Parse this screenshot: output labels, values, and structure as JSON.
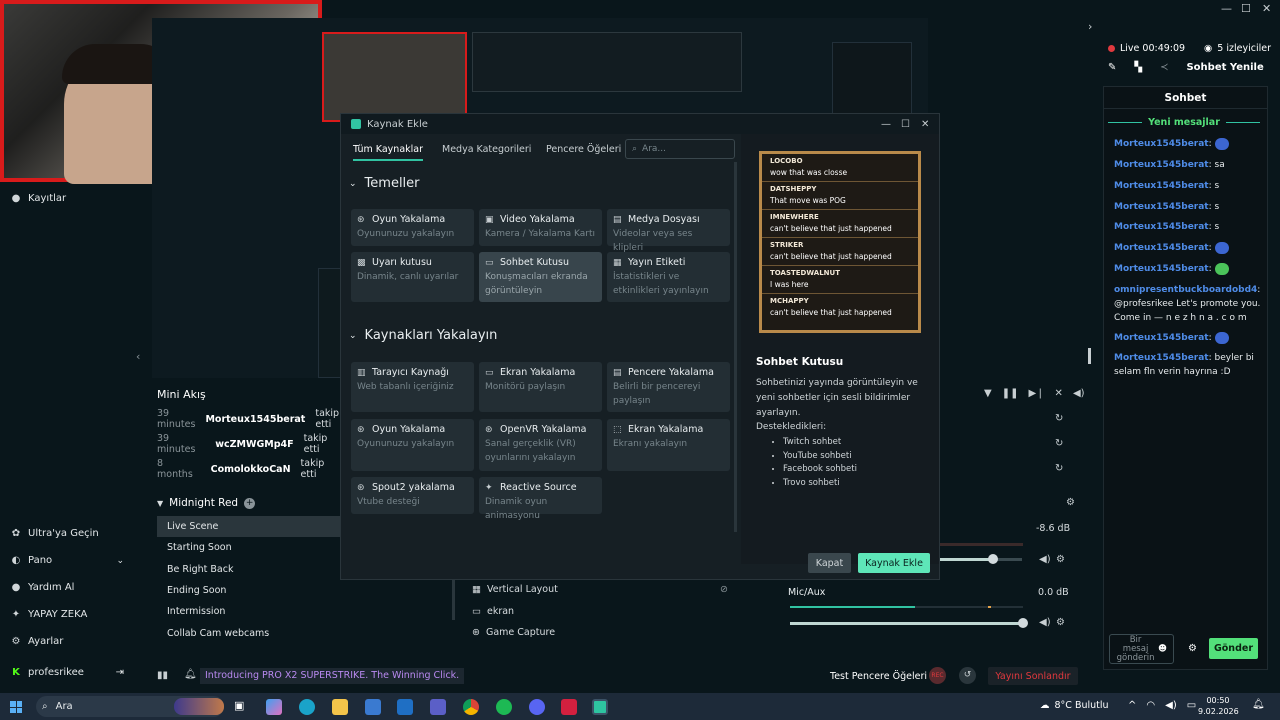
{
  "stream_status": {
    "live_label": "Live 00:49:09",
    "viewers": "5 izleyiciler",
    "refresh_chat": "Sohbet Yenile"
  },
  "sidebar": {
    "recordings": "Kayıtlar",
    "bottom_items": [
      {
        "label": "Ultra'ya Geçin",
        "icon": "ultra-icon"
      },
      {
        "label": "Pano",
        "icon": "dashboard-icon"
      },
      {
        "label": "Yardım Al",
        "icon": "help-icon"
      },
      {
        "label": "YAPAY ZEKA",
        "icon": "ai-icon"
      },
      {
        "label": "Ayarlar",
        "icon": "gear-icon"
      },
      {
        "label": "profesrikee",
        "icon": "kick-icon"
      }
    ]
  },
  "mini_feed": {
    "title": "Mini Akış",
    "rows": [
      {
        "time": "39 minutes",
        "user": "Morteux1545berat",
        "action": "takip etti"
      },
      {
        "time": "39 minutes",
        "user": "wcZMWGMp4F",
        "action": "takip etti"
      },
      {
        "time": "8 months",
        "user": "ComolokkoCaN",
        "action": "takip etti"
      }
    ]
  },
  "scenes": {
    "collection": "Midnight Red",
    "items": [
      "Live Scene",
      "Starting Soon",
      "Be Right Back",
      "Ending Soon",
      "Intermission",
      "Collab Cam webcams"
    ]
  },
  "sources": [
    "Vertical Layout",
    "ekran",
    "Game Capture"
  ],
  "mixer": {
    "level1": "-8.6 dB",
    "mic_label": "Mic/Aux",
    "mic_level": "0.0 dB",
    "volume1": 0.65,
    "volume2": 1.0
  },
  "dialog": {
    "title": "Kaynak Ekle",
    "tabs": [
      "Tüm Kaynaklar",
      "Medya Kategorileri",
      "Pencere Öğeleri"
    ],
    "search_placeholder": "Ara...",
    "section1": "Temeller",
    "section2": "Kaynakları Yakalayın",
    "cards1": [
      {
        "title": "Oyun Yakalama",
        "desc": "Oyununuzu yakalayın"
      },
      {
        "title": "Video Yakalama",
        "desc": "Kamera / Yakalama Kartı"
      },
      {
        "title": "Medya Dosyası",
        "desc": "Videolar veya ses klipleri"
      },
      {
        "title": "Uyarı kutusu",
        "desc": "Dinamik, canlı uyarılar"
      },
      {
        "title": "Sohbet Kutusu",
        "desc": "Konuşmacıları ekranda görüntüleyin"
      },
      {
        "title": "Yayın Etiketi",
        "desc": "İstatistikleri ve etkinlikleri yayınlayın"
      }
    ],
    "cards2": [
      {
        "title": "Tarayıcı Kaynağı",
        "desc": "Web tabanlı içeriğiniz"
      },
      {
        "title": "Ekran Yakalama",
        "desc": "Monitörü paylaşın"
      },
      {
        "title": "Pencere Yakalama",
        "desc": "Belirli bir pencereyi paylaşın"
      },
      {
        "title": "Oyun Yakalama",
        "desc": "Oyununuzu yakalayın"
      },
      {
        "title": "OpenVR Yakalama",
        "desc": "Sanal gerçeklik (VR) oyunlarını yakalayın"
      },
      {
        "title": "Ekran Yakalama",
        "desc": "Ekranı yakalayın"
      },
      {
        "title": "Spout2 yakalama",
        "desc": "Vtube desteği"
      },
      {
        "title": "Reactive Source",
        "desc": "Dinamik oyun animasyonu"
      }
    ],
    "preview_chat": [
      {
        "name": "LOCOBO",
        "msg": "wow that was closse"
      },
      {
        "name": "DATSHEPPY",
        "msg": "That move was POG"
      },
      {
        "name": "IMNEWHERE",
        "msg": "can't believe that just happened"
      },
      {
        "name": "STRIKER",
        "msg": "can't believe that just happened"
      },
      {
        "name": "TOASTEDWALNUT",
        "msg": "I was here"
      },
      {
        "name": "MCHAPPY",
        "msg": "can't believe that just happened"
      }
    ],
    "detail_title": "Sohbet Kutusu",
    "detail_desc": "Sohbetinizi yayında görüntüleyin ve yeni sohbetler için sesli bildirimler ayarlayın.",
    "supported_label": "Desteklediklerі:",
    "supported": [
      "Twitch sohbet",
      "YouTube sohbeti",
      "Facebook sohbeti",
      "Trovo sohbeti"
    ],
    "close_btn": "Kapat",
    "add_btn": "Kaynak Ekle"
  },
  "chat": {
    "title": "Sohbet",
    "new_messages": "Yeni mesajlar",
    "messages": [
      {
        "user": "Morteux1545berat",
        "text": "",
        "emote": "blue"
      },
      {
        "user": "Morteux1545berat",
        "text": "sa",
        "emote": ""
      },
      {
        "user": "Morteux1545berat",
        "text": "s",
        "emote": ""
      },
      {
        "user": "Morteux1545berat",
        "text": "s",
        "emote": ""
      },
      {
        "user": "Morteux1545berat",
        "text": "s",
        "emote": ""
      },
      {
        "user": "Morteux1545berat",
        "text": "",
        "emote": "blue"
      },
      {
        "user": "Morteux1545berat",
        "text": "",
        "emote": "green"
      }
    ],
    "promo_user": "omnipresentbuckboardobd4",
    "promo_text": "@profesrikee Let's promote you. Come in — n e z h n a . c o m",
    "msg_after1_user": "Morteux1545berat",
    "msg_after2_user": "Morteux1545berat",
    "msg_after2_text": "beyler bi selam fln verin hayrına :D",
    "input_placeholder": "Bir mesaj gönderin",
    "send": "Gönder"
  },
  "footer": {
    "promo": "Introducing PRO X2 SUPERSTRIKE. The Winning Click.",
    "test_windows": "Test Pencere Öğeleri",
    "end_stream": "Yayını Sonlandır"
  },
  "taskbar": {
    "search": "Ara",
    "weather": "8°C  Bulutlu",
    "time": "00:50",
    "date": "9.02.2026"
  },
  "colors": {
    "accent": "#31c3a2",
    "live_red": "#e0393e",
    "chat_user": "#4f8ce8"
  }
}
